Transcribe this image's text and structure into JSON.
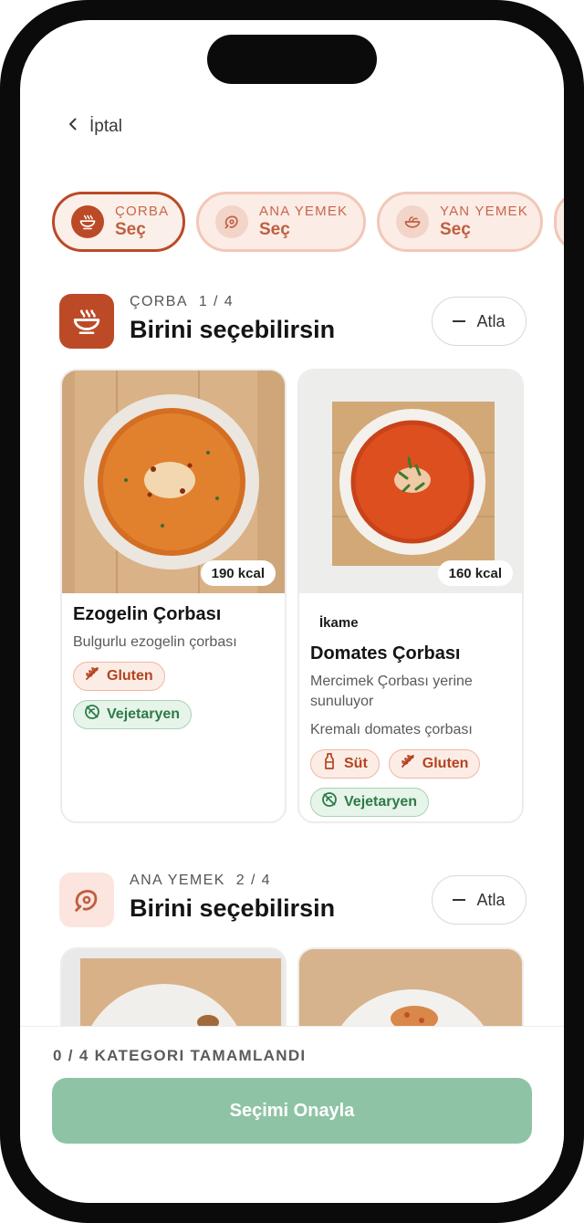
{
  "nav": {
    "cancel_label": "İptal"
  },
  "tabs": [
    {
      "category": "ÇORBA",
      "select_label": "Seç",
      "icon": "soup-bowl-icon",
      "active": true
    },
    {
      "category": "ANA YEMEK",
      "select_label": "Seç",
      "icon": "meat-icon",
      "active": false
    },
    {
      "category": "YAN YEMEK",
      "select_label": "Seç",
      "icon": "salad-bowl-icon",
      "active": false
    }
  ],
  "sections": [
    {
      "kicker": "ÇORBA",
      "count": "1 / 4",
      "title": "Birini seçebilirsin",
      "skip_label": "Atla",
      "icon": "soup-bowl-icon",
      "cards": [
        {
          "kcal": "190 kcal",
          "name": "Ezogelin Çorbası",
          "description": "Bulgurlu ezogelin çorbası",
          "tags": [
            {
              "label": "Gluten",
              "icon": "wheat-icon",
              "kind": "allergen"
            },
            {
              "label": "Vejetaryen",
              "icon": "no-meat-icon",
              "kind": "diet"
            }
          ]
        },
        {
          "kcal": "160 kcal",
          "substitute_badge": "İkame",
          "name": "Domates Çorbası",
          "substitute_note": "Mercimek Çorbası yerine sunuluyor",
          "description": "Kremalı domates çorbası",
          "tags": [
            {
              "label": "Süt",
              "icon": "milk-bottle-icon",
              "kind": "allergen"
            },
            {
              "label": "Gluten",
              "icon": "wheat-icon",
              "kind": "allergen"
            },
            {
              "label": "Vejetaryen",
              "icon": "no-meat-icon",
              "kind": "diet"
            }
          ]
        }
      ]
    },
    {
      "kicker": "ANA YEMEK",
      "count": "2 / 4",
      "title": "Birini seçebilirsin",
      "skip_label": "Atla",
      "icon": "meat-icon"
    }
  ],
  "footer": {
    "progress_text": "0 / 4 KATEGORI TAMAMLANDI",
    "confirm_label": "Seçimi Onayla"
  },
  "colors": {
    "accent": "#bb4a27",
    "accent_soft": "#fbece6",
    "veg_green": "#2e7b46",
    "confirm_disabled": "#8fc3a5"
  }
}
